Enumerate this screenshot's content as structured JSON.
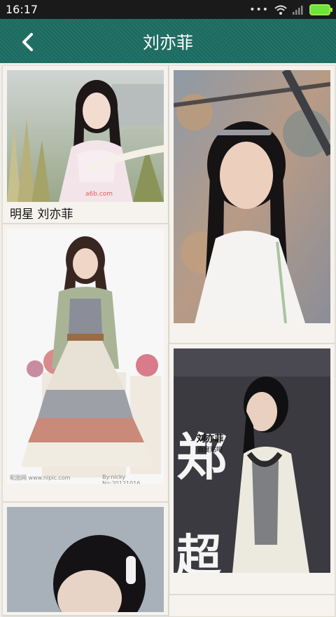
{
  "status_bar": {
    "time": "16:17",
    "icons": [
      "more-dots-icon",
      "wifi-icon",
      "signal-icon",
      "battery-icon"
    ]
  },
  "app_bar": {
    "title": "刘亦菲",
    "back_icon": "chevron-left-icon"
  },
  "colors": {
    "app_bar": "#1d6d62",
    "background": "#f1efea",
    "card": "#f6f3ee"
  },
  "cards": [
    {
      "caption": "明星 刘亦菲",
      "watermark": "a6b.com"
    },
    {
      "caption": ""
    },
    {
      "caption": "",
      "watermark_left": "昵图网 www.nipic.com",
      "watermark_right": "By:nicky No:20121016..."
    },
    {
      "caption": "",
      "logo_text": "刘亦菲",
      "logo_sub": "百度贴吧",
      "bg_chars": [
        "郑",
        "超"
      ]
    },
    {
      "caption": ""
    },
    {
      "caption": ""
    }
  ]
}
